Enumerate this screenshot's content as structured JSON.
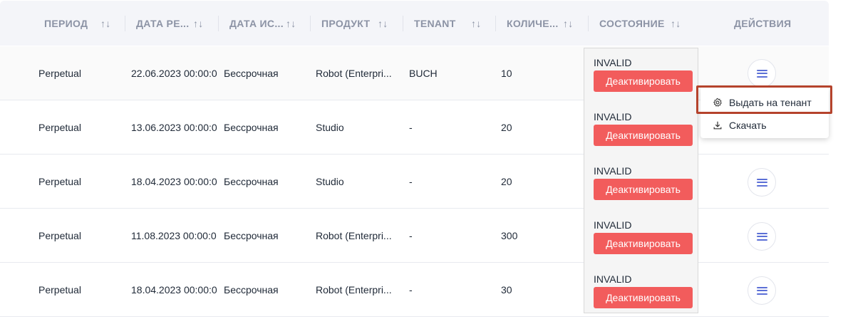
{
  "table": {
    "headers": [
      {
        "label": "ПЕРИОД",
        "sort_icon": "↑↓"
      },
      {
        "label": "ДАТА РЕ...",
        "sort_icon": "↑↓"
      },
      {
        "label": "ДАТА ИС...",
        "sort_icon": "↑↓"
      },
      {
        "label": "ПРОДУКТ",
        "sort_icon": "↑↓"
      },
      {
        "label": "TENANT",
        "sort_icon": "↑↓"
      },
      {
        "label": "КОЛИЧЕ...",
        "sort_icon": "↑↓"
      },
      {
        "label": "СОСТОЯНИЕ",
        "sort_icon": "↑↓"
      },
      {
        "label": "ДЕЙСТВИЯ"
      }
    ],
    "rows": [
      {
        "period": "Perpetual",
        "date_reg": "22.06.2023 00:00:0",
        "date_exp": "Бессрочная",
        "product": "Robot (Enterpri...",
        "tenant": "BUCH",
        "qty": "10",
        "status": "INVALID",
        "action_label": "Деактивировать"
      },
      {
        "period": "Perpetual",
        "date_reg": "13.06.2023 00:00:0",
        "date_exp": "Бессрочная",
        "product": "Studio",
        "tenant": "-",
        "qty": "20",
        "status": "INVALID",
        "action_label": "Деактивировать"
      },
      {
        "period": "Perpetual",
        "date_reg": "18.04.2023 00:00:0",
        "date_exp": "Бессрочная",
        "product": "Studio",
        "tenant": "-",
        "qty": "20",
        "status": "INVALID",
        "action_label": "Деактивировать"
      },
      {
        "period": "Perpetual",
        "date_reg": "11.08.2023 00:00:0",
        "date_exp": "Бессрочная",
        "product": "Robot (Enterpri...",
        "tenant": "-",
        "qty": "300",
        "status": "INVALID",
        "action_label": "Деактивировать"
      },
      {
        "period": "Perpetual",
        "date_reg": "18.04.2023 00:00:0",
        "date_exp": "Бессрочная",
        "product": "Robot (Enterpri...",
        "tenant": "-",
        "qty": "30",
        "status": "INVALID",
        "action_label": "Деактивировать"
      }
    ]
  },
  "dropdown_menu": {
    "items": [
      {
        "label": "Выдать на тенант",
        "icon": "gear-icon"
      },
      {
        "label": "Скачать",
        "icon": "download-icon"
      }
    ]
  },
  "colors": {
    "accent": "#5b6fd6",
    "danger": "#f25c5c",
    "highlight": "#b5432c"
  }
}
